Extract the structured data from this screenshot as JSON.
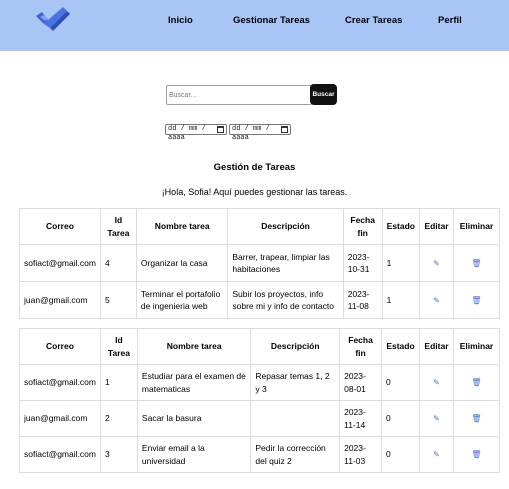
{
  "nav": {
    "items": [
      "Inicio",
      "Gestionar Tareas",
      "Crear Tareas",
      "Perfil"
    ]
  },
  "search": {
    "placeholder": "Buscar...",
    "button_label": "Buscar"
  },
  "date_filters": {
    "start_placeholder": "dd / mm / aaaa",
    "end_placeholder": "dd / mm / aaaa"
  },
  "page": {
    "title": "Gestión de Tareas",
    "greeting": "¡Hola, Sofia! Aquí puedes gestionar las tareas."
  },
  "columns": [
    "Correo",
    "Id Tarea",
    "Nombre tarea",
    "Descripción",
    "Fecha fin",
    "Estado",
    "Editar",
    "Eliminar"
  ],
  "table1": {
    "rows": [
      {
        "correo": "sofiact@gmail.com",
        "id": "4",
        "nombre": "Organizar la casa",
        "descripcion": "Barrer, trapear, limpiar las habitaciones",
        "fecha": "2023-10-31",
        "estado": "1"
      },
      {
        "correo": "juan@gmail.com",
        "id": "5",
        "nombre": "Terminar el portafolio de ingenieria web",
        "descripcion": "Subir los proyectos, info sobre mi y info de contacto",
        "fecha": "2023-11-08",
        "estado": "1"
      }
    ]
  },
  "table2": {
    "rows": [
      {
        "correo": "sofiact@gmail.com",
        "id": "1",
        "nombre": "Estudiar para el examen de matematicas",
        "descripcion": "Repasar temas 1, 2 y 3",
        "fecha": "2023-08-01",
        "estado": "0"
      },
      {
        "correo": "juan@gmail.com",
        "id": "2",
        "nombre": "Sacar la basura",
        "descripcion": "",
        "fecha": "2023-11-14",
        "estado": "0"
      },
      {
        "correo": "sofiact@gmail.com",
        "id": "3",
        "nombre": "Enviar email a la universidad",
        "descripcion": "Pedir la corrección del quiz 2",
        "fecha": "2023-11-03",
        "estado": "0"
      }
    ]
  },
  "icons": {
    "edit": "edit-icon",
    "delete": "trash-icon"
  },
  "colors": {
    "navbar": "#a8c5f5",
    "accent": "#4a6fd6",
    "button": "#111111"
  }
}
